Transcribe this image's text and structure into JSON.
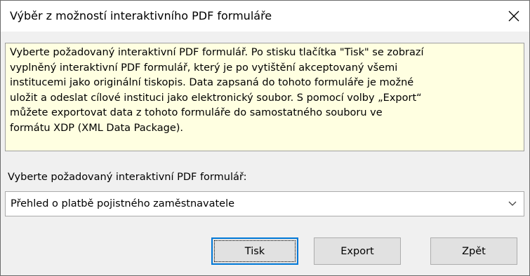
{
  "window": {
    "title": "Výběr z možností interaktivního PDF formuláře"
  },
  "info": {
    "text": "Vyberte požadovaný interaktivní PDF formulář. Po stisku tlačítka \"Tisk\" se zobrazí\nvyplněný interaktivní PDF formulář, který je po vytištění akceptovaný všemi\ninstitucemi jako originální tiskopis. Data zapsaná do tohoto formuláře je možné\nuložit a odeslat cílové instituci jako elektronický soubor. S pomocí volby „Export“\nmůžete exportovat data z tohoto formuláře do samostatného souboru ve\nformátu XDP (XML Data Package)."
  },
  "form": {
    "select_label": "Vyberte požadovaný interaktivní PDF formulář:",
    "selected_value": "Přehled o platbě pojistného zaměstnavatele"
  },
  "buttons": {
    "print": "Tisk",
    "export": "Export",
    "back": "Zpět"
  },
  "colors": {
    "info_background": "#ffffe1",
    "focus_border": "#0078d7",
    "button_face": "#e1e1e1"
  },
  "icons": {
    "close": "close-icon",
    "dropdown": "chevron-down-icon"
  }
}
